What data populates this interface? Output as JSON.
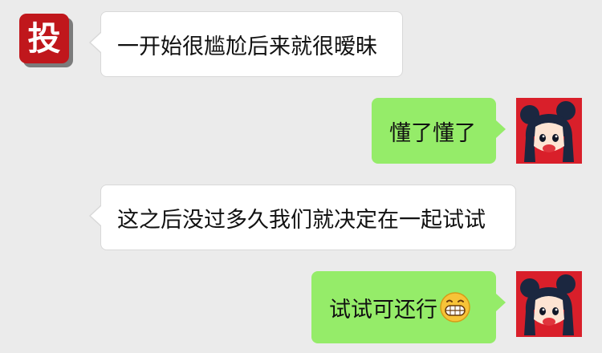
{
  "chat": {
    "messages": [
      {
        "side": "left",
        "text": "一开始很尴尬后来就很暧昧"
      },
      {
        "side": "right",
        "text": "懂了懂了"
      },
      {
        "side": "left",
        "text": "这之后没过多久我们就决定在一起试试"
      },
      {
        "side": "right",
        "text": "试试可还行",
        "emoji": "grinning-face-emoji"
      }
    ],
    "left_avatar": {
      "char": "投",
      "icon": "tou-avatar-icon"
    },
    "right_avatar": {
      "icon": "cartoon-girl-avatar-icon"
    }
  },
  "colors": {
    "background": "#ebebeb",
    "bubble_in": "#ffffff",
    "bubble_out": "#95ec69",
    "left_avatar_bg": "#c0171c",
    "right_avatar_bg": "#d91f2a"
  }
}
